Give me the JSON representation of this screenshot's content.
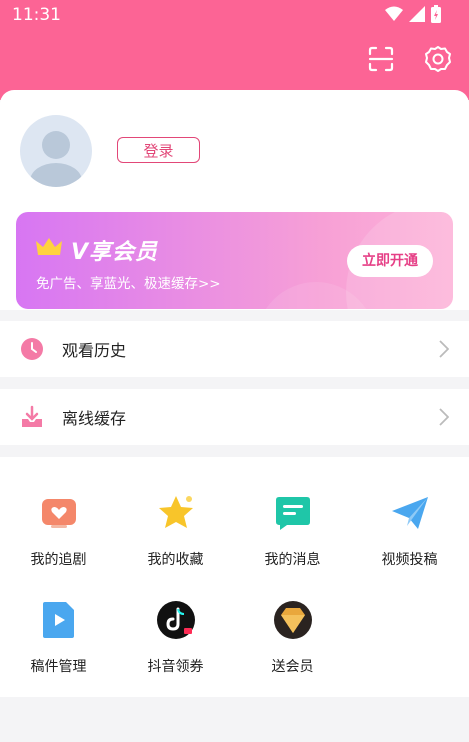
{
  "status_bar": {
    "time": "11:31"
  },
  "profile": {
    "login_label": "登录"
  },
  "vip_banner": {
    "title": "V享会员",
    "description": "免广告、享蓝光、极速缓存>>",
    "cta_label": "立即开通"
  },
  "menu": [
    {
      "label": "观看历史",
      "icon": "clock-icon",
      "color": "#f47aa6"
    },
    {
      "label": "离线缓存",
      "icon": "download-icon",
      "color": "#f47aa6"
    }
  ],
  "grid": [
    {
      "label": "我的追剧",
      "icon": "heart-tv-icon",
      "color": "#f4876a"
    },
    {
      "label": "我的收藏",
      "icon": "star-icon",
      "color": "#f8c52a"
    },
    {
      "label": "我的消息",
      "icon": "message-icon",
      "color": "#1fc6a8"
    },
    {
      "label": "视频投稿",
      "icon": "paper-plane-icon",
      "color": "#4aa7ef"
    },
    {
      "label": "稿件管理",
      "icon": "video-file-icon",
      "color": "#4aa7ef"
    },
    {
      "label": "抖音领券",
      "icon": "tiktok-icon",
      "color": "#111111"
    },
    {
      "label": "送会员",
      "icon": "vip-badge-icon",
      "color": "#222222"
    }
  ]
}
